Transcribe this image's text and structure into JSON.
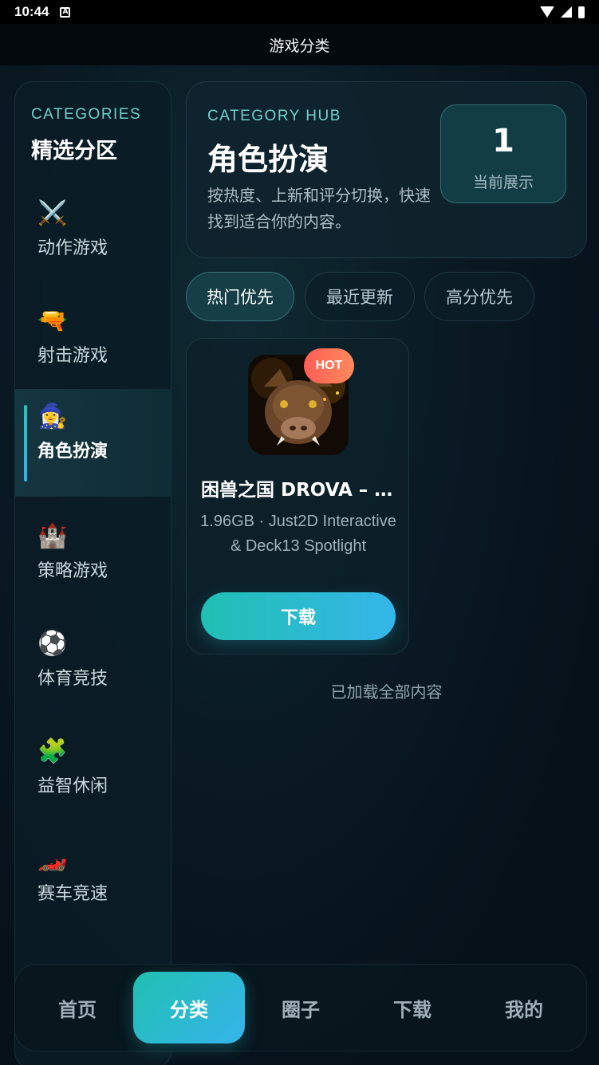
{
  "status_bar": {
    "time": "10:44",
    "notification_letter": "A"
  },
  "app_bar": {
    "title": "游戏分类"
  },
  "sidebar": {
    "eyebrow": "CATEGORIES",
    "title": "精选分区",
    "items": [
      {
        "label": "动作游戏",
        "icon": "⚔️",
        "icon_name": "crossed-swords-icon"
      },
      {
        "label": "射击游戏",
        "icon": "🔫",
        "icon_name": "water-pistol-icon"
      },
      {
        "label": "角色扮演",
        "icon": "🧙‍♀️",
        "icon_name": "mage-icon",
        "active": true
      },
      {
        "label": "策略游戏",
        "icon": "🏰",
        "icon_name": "castle-icon"
      },
      {
        "label": "体育竞技",
        "icon": "⚽",
        "icon_name": "soccer-ball-icon"
      },
      {
        "label": "益智休闲",
        "icon": "🧩",
        "icon_name": "puzzle-icon"
      },
      {
        "label": "赛车竞速",
        "icon": "🏎️",
        "icon_name": "race-car-icon"
      }
    ]
  },
  "hub": {
    "eyebrow": "CATEGORY HUB",
    "title": "角色扮演",
    "description": "按热度、上新和评分切换，快速找到适合你的内容。",
    "stat_value": "1",
    "stat_label": "当前展示"
  },
  "sort_tabs": [
    {
      "label": "热门优先",
      "active": true
    },
    {
      "label": "最近更新"
    },
    {
      "label": "高分优先"
    }
  ],
  "games": [
    {
      "badge": "HOT",
      "title": "困兽之国 DROVA – …",
      "meta": "1.96GB · Just2D Interactive & Deck13 Spotlight",
      "download_label": "下载"
    }
  ],
  "list_footer": "已加载全部内容",
  "bottom_nav": [
    {
      "label": "首页"
    },
    {
      "label": "分类",
      "active": true
    },
    {
      "label": "圈子"
    },
    {
      "label": "下载"
    },
    {
      "label": "我的"
    }
  ],
  "colors": {
    "accent_start": "#20bfb3",
    "accent_end": "#35b6ea",
    "hot_badge": "#ff6a57",
    "eyebrow": "#6fd0cf"
  }
}
